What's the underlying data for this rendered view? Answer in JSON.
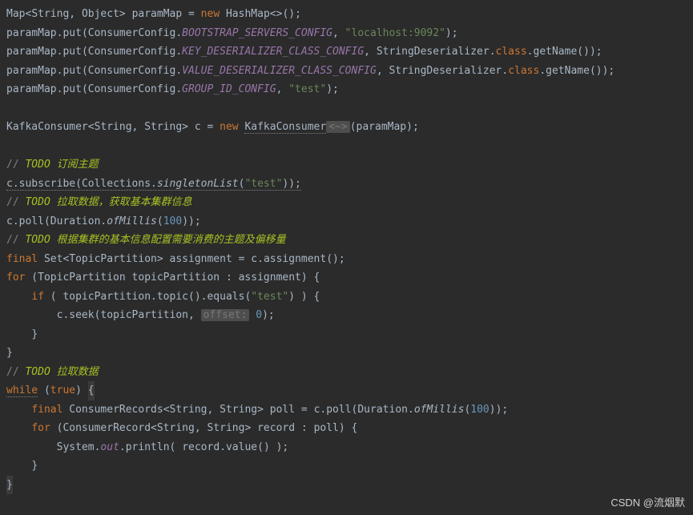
{
  "code": {
    "l1": {
      "type1": "Map",
      "gen1": "String",
      "gen2": "Object",
      "var": "paramMap",
      "kw_new": "new",
      "ctor": "HashMap",
      "diamond": "<>"
    },
    "l2": {
      "obj": "paramMap",
      "m": "put",
      "cls": "ConsumerConfig",
      "field": "BOOTSTRAP_SERVERS_CONFIG",
      "str": "\"localhost:9092\""
    },
    "l3": {
      "obj": "paramMap",
      "m": "put",
      "cls": "ConsumerConfig",
      "field": "KEY_DESERIALIZER_CLASS_CONFIG",
      "cls2": "StringDeserializer",
      "kw_class": "class",
      "m2": "getName"
    },
    "l4": {
      "obj": "paramMap",
      "m": "put",
      "cls": "ConsumerConfig",
      "field": "VALUE_DESERIALIZER_CLASS_CONFIG",
      "cls2": "StringDeserializer",
      "kw_class": "class",
      "m2": "getName"
    },
    "l5": {
      "obj": "paramMap",
      "m": "put",
      "cls": "ConsumerConfig",
      "field": "GROUP_ID_CONFIG",
      "str": "\"test\""
    },
    "l7": {
      "type": "KafkaConsumer",
      "gen1": "String",
      "gen2": "String",
      "var": "c",
      "kw_new": "new",
      "ctor": "KafkaConsumer",
      "diamond": "<~>",
      "arg": "paramMap"
    },
    "c1": {
      "slashes": "// ",
      "todo": "TODO 订阅主题"
    },
    "l9": {
      "obj": "c",
      "m": "subscribe",
      "cls": "Collections",
      "smethod": "singletonList",
      "str": "\"test\""
    },
    "c2": {
      "slashes": "// ",
      "todo": "TODO 拉取数据，获取基本集群信息"
    },
    "l11": {
      "obj": "c",
      "m": "poll",
      "cls": "Duration",
      "smethod": "ofMillis",
      "num": "100"
    },
    "c3": {
      "slashes": "// ",
      "todo": "TODO 根据集群的基本信息配置需要消费的主题及偏移量"
    },
    "l13": {
      "kw_final": "final",
      "type": "Set",
      "gen": "TopicPartition",
      "var": "assignment",
      "obj": "c",
      "m": "assignment"
    },
    "l14": {
      "kw_for": "for",
      "type": "TopicPartition",
      "var": "topicPartition",
      "coll": "assignment"
    },
    "l15": {
      "kw_if": "if",
      "obj": "topicPartition",
      "m1": "topic",
      "m2": "equals",
      "str": "\"test\""
    },
    "l16": {
      "obj": "c",
      "m": "seek",
      "arg1": "topicPartition",
      "hint": "offset:",
      "num": "0"
    },
    "l17": {
      "brace": "}"
    },
    "l18": {
      "brace": "}"
    },
    "c4": {
      "slashes": "// ",
      "todo": "TODO 拉取数据"
    },
    "l20": {
      "kw_while": "while",
      "kw_true": "true"
    },
    "l21": {
      "kw_final": "final",
      "type": "ConsumerRecords",
      "gen1": "String",
      "gen2": "String",
      "var": "poll",
      "obj": "c",
      "m": "poll",
      "cls": "Duration",
      "smethod": "ofMillis",
      "num": "100"
    },
    "l22": {
      "kw_for": "for",
      "type": "ConsumerRecord",
      "gen1": "String",
      "gen2": "String",
      "var": "record",
      "coll": "poll"
    },
    "l23": {
      "cls": "System",
      "field": "out",
      "m": "println",
      "arg": "record",
      "m2": "value"
    },
    "l24": {
      "brace": "}"
    },
    "l25": {
      "brace": "}"
    }
  },
  "watermark": "CSDN @流烟默"
}
